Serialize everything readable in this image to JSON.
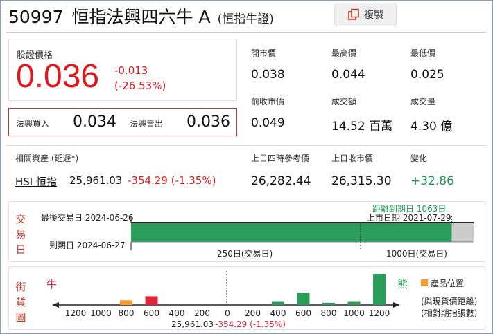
{
  "header": {
    "code": "50997",
    "name": "恒指法興四六牛 A",
    "subname": "(恒指牛證)",
    "copy_label": "複製"
  },
  "price": {
    "label": "股證價格",
    "value": "0.036",
    "change": "-0.013",
    "change_pct": "(-26.53%)"
  },
  "bidask": {
    "bid_label": "法興買入",
    "bid_value": "0.034",
    "ask_label": "法興賣出",
    "ask_value": "0.036"
  },
  "stats": {
    "open_label": "開市價",
    "open": "0.038",
    "high_label": "最高價",
    "high": "0.044",
    "low_label": "最低價",
    "low": "0.025",
    "prev_label": "前收市價",
    "prev": "0.049",
    "turnover_label": "成交額",
    "turnover": "14.52 百萬",
    "volume_label": "成交量",
    "volume": "4.30 億"
  },
  "related": {
    "label": "相關資產 (延遲*)",
    "asset_link": "HSI 恒指",
    "asset_value": "25,961.03",
    "asset_change": "-354.29 (-1.35%)",
    "ref_label": "上日四時參考價",
    "ref": "26,282.44",
    "close_label": "上日收市價",
    "close": "26,315.30",
    "chg_label": "變化",
    "chg": "+32.86"
  },
  "trading": {
    "title": [
      "交",
      "易",
      "日"
    ],
    "last_trade": "最後交易日 2024-06-26",
    "expiry": "到期日 2024-06-27",
    "days_to_expiry": "距離到期日 1063日",
    "listing": "上市日期 2021-07-29",
    "mark_250": "250日(交易日)",
    "mark_1000": "1000日(交易日)",
    "elapsed_fraction": 0.936
  },
  "street": {
    "title": [
      "街",
      "貨",
      "圖"
    ],
    "bull_label": "牛",
    "bear_label": "熊",
    "legend": "產品位置",
    "legend_note1": "(與現貨價距離)",
    "legend_note2": "(相對期指張數)",
    "spot_text": "25,961.03",
    "spot_change": "-354.29 (-1.35%)",
    "ticks": [
      "1200",
      "1000",
      "800",
      "600",
      "400",
      "200",
      "0",
      "200",
      "400",
      "600",
      "800",
      "1000",
      "1200"
    ],
    "colors": {
      "bull": "#e0243c",
      "bear": "#2a9d5a",
      "product": "#f39c32"
    }
  },
  "chart_data": {
    "type": "bar",
    "categories": [
      "-1200",
      "-1000",
      "-800",
      "-600",
      "-400",
      "-200",
      "0",
      "200",
      "400",
      "600",
      "800",
      "1000",
      "1200"
    ],
    "series": [
      {
        "name": "牛",
        "values": [
          0,
          0,
          0.15,
          0.28,
          0,
          0,
          0,
          0,
          0,
          0,
          0,
          0,
          0
        ]
      },
      {
        "name": "熊",
        "values": [
          0,
          0,
          0,
          0,
          0,
          0,
          0,
          0,
          0.1,
          0.4,
          0.07,
          0.1,
          1.0
        ]
      }
    ],
    "product_position": "-800"
  }
}
